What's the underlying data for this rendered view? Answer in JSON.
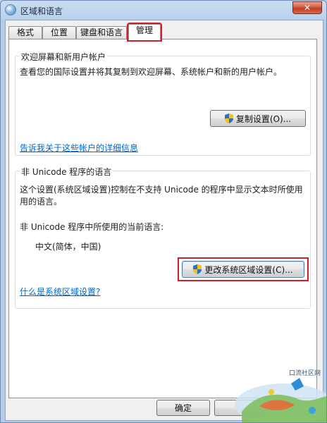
{
  "window": {
    "title": "区域和语言",
    "close_glyph": "✕"
  },
  "tabs": [
    {
      "label": "格式"
    },
    {
      "label": "位置"
    },
    {
      "label": "键盘和语言"
    },
    {
      "label": "管理"
    }
  ],
  "welcome_group": {
    "title": "欢迎屏幕和新用户帐户",
    "description": "查看您的国际设置并将其复制到欢迎屏幕、系统帐户和新的用户帐户。",
    "copy_button": "复制设置(O)...",
    "details_link": "告诉我关于这些帐户的详细信息"
  },
  "unicode_group": {
    "title": "非 Unicode 程序的语言",
    "description_line1": "这个设置(系统区域设置)控制在不支持 Unicode 的程序中显示文本时所使用",
    "description_line2": "用的语言。",
    "current_label": "非 Unicode 程序中所使用的当前语言:",
    "current_value": "中文(简体，中国)",
    "change_button": "更改系统区域设置(C)...",
    "what_link": "什么是系统区域设置?"
  },
  "footer": {
    "ok_button": "确定"
  },
  "watermark": {
    "text": "口流社区网"
  },
  "colors": {
    "highlight": "#d0202a",
    "link": "#0066cc"
  }
}
